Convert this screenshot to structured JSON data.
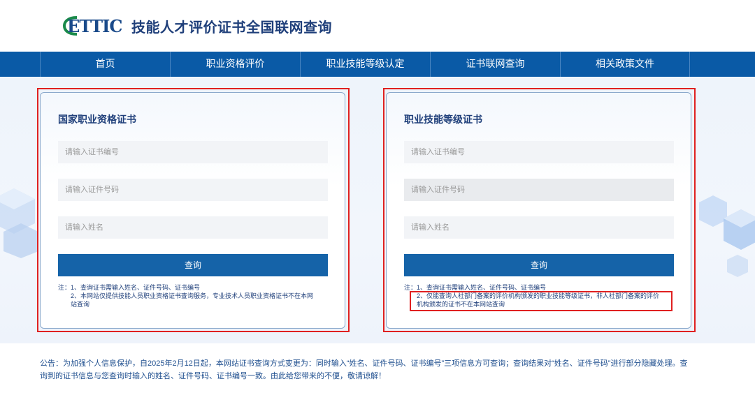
{
  "header": {
    "logo_text": "ETTIC",
    "site_title": "技能人才评价证书全国联网查询"
  },
  "nav": {
    "items": [
      "首页",
      "职业资格评价",
      "职业技能等级认定",
      "证书联网查询",
      "相关政策文件"
    ]
  },
  "left_card": {
    "title": "国家职业资格证书",
    "cert_number_placeholder": "请输入证书编号",
    "id_number_placeholder": "请输入证件号码",
    "name_placeholder": "请输入姓名",
    "query_label": "查询",
    "note_line1": "注：1、查询证书需输入姓名、证件号码、证书编号",
    "note_line2": "2、本网站仅提供技能人员职业资格证书查询服务，专业技术人员职业资格证书不在本网",
    "note_line3": "站查询"
  },
  "right_card": {
    "title": "职业技能等级证书",
    "cert_number_placeholder": "请输入证书编号",
    "id_number_placeholder": "请输入证件号码",
    "name_placeholder": "请输入姓名",
    "query_label": "查询",
    "note_line1": "注：1、查询证书需输入姓名、证件号码、证书编号",
    "note_line2": "2、仅能查询人社部门备案的评价机构颁发的职业技能等级证书，非人社部门备案的评价",
    "note_line3": "机构颁发的证书不在本网站查询"
  },
  "announcement": {
    "text": "公告：为加强个人信息保护，自2025年2月12日起，本网站证书查询方式变更为：同时输入“姓名、证件号码、证书编号”三项信息方可查询；查询结果对“姓名、证件号码”进行部分隐藏处理。查询到的证书信息与您查询时输入的姓名、证件号码、证书编号一致。由此给您带来的不便，敬请谅解！"
  },
  "colors": {
    "nav_bg": "#0a5aa6",
    "button_bg": "#1563a8",
    "title_text": "#1f3f7a",
    "highlight_frame": "#e02020"
  }
}
